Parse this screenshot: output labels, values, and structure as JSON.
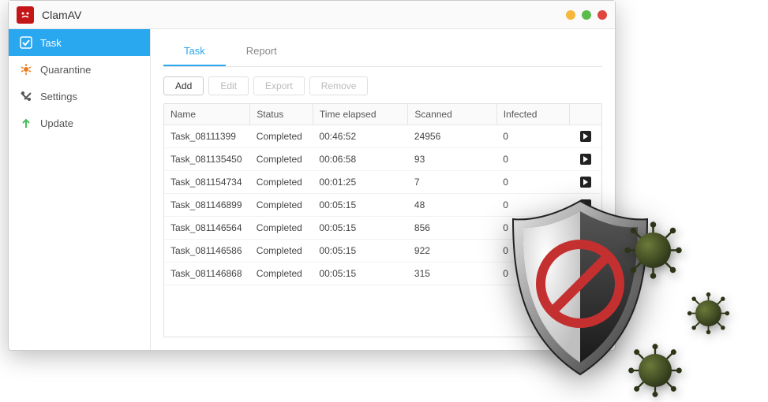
{
  "titlebar": {
    "title": "ClamAV"
  },
  "sidebar": {
    "items": [
      {
        "label": "Task",
        "icon": "check-icon",
        "active": true
      },
      {
        "label": "Quarantine",
        "icon": "quarantine-icon",
        "active": false
      },
      {
        "label": "Settings",
        "icon": "settings-icon",
        "active": false
      },
      {
        "label": "Update",
        "icon": "update-icon",
        "active": false
      }
    ]
  },
  "tabs": [
    {
      "label": "Task",
      "active": true
    },
    {
      "label": "Report",
      "active": false
    }
  ],
  "toolbar": {
    "add": "Add",
    "edit": "Edit",
    "export": "Export",
    "remove": "Remove"
  },
  "table": {
    "headers": {
      "name": "Name",
      "status": "Status",
      "time": "Time elapsed",
      "scanned": "Scanned",
      "infected": "Infected"
    },
    "rows": [
      {
        "name": "Task_08111399",
        "status": "Completed",
        "time": "00:46:52",
        "scanned": "24956",
        "infected": "0"
      },
      {
        "name": "Task_081135450",
        "status": "Completed",
        "time": "00:06:58",
        "scanned": "93",
        "infected": "0"
      },
      {
        "name": "Task_081154734",
        "status": "Completed",
        "time": "00:01:25",
        "scanned": "7",
        "infected": "0"
      },
      {
        "name": "Task_081146899",
        "status": "Completed",
        "time": "00:05:15",
        "scanned": "48",
        "infected": "0"
      },
      {
        "name": "Task_081146564",
        "status": "Completed",
        "time": "00:05:15",
        "scanned": "856",
        "infected": "0"
      },
      {
        "name": "Task_081146586",
        "status": "Completed",
        "time": "00:05:15",
        "scanned": "922",
        "infected": "0"
      },
      {
        "name": "Task_081146868",
        "status": "Completed",
        "time": "00:05:15",
        "scanned": "315",
        "infected": "0"
      }
    ]
  },
  "colors": {
    "accent": "#29a7ef",
    "logo": "#c41616"
  }
}
